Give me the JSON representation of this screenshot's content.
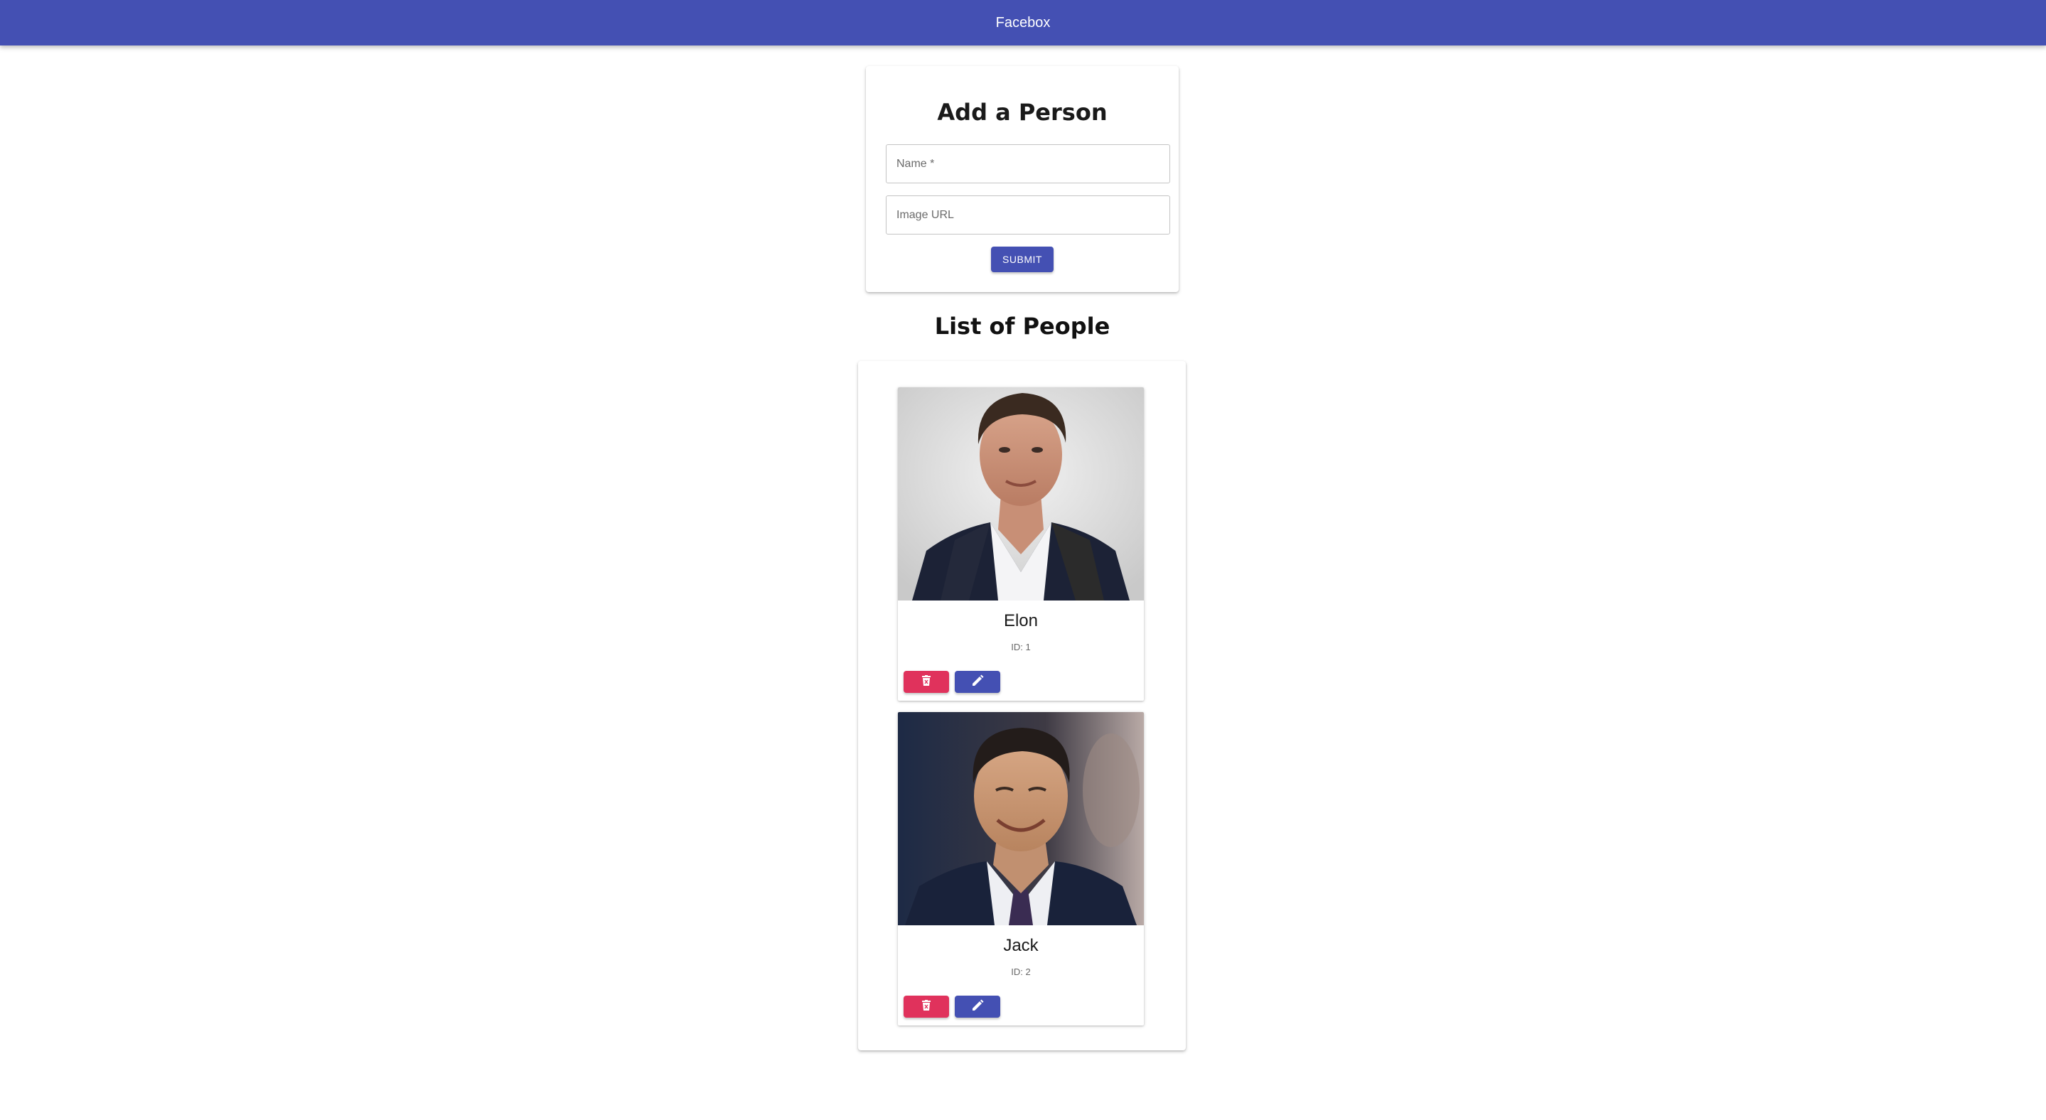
{
  "appbar": {
    "title": "Facebox"
  },
  "form": {
    "title": "Add a Person",
    "name_placeholder": "Name *",
    "name_value": "",
    "url_placeholder": "Image URL",
    "url_value": "",
    "submit_label": "SUBMIT"
  },
  "list": {
    "title": "List of People",
    "people": [
      {
        "name": "Elon",
        "id_text": "ID: 1"
      },
      {
        "name": "Jack",
        "id_text": "ID: 2"
      }
    ]
  },
  "colors": {
    "primary": "#4450b3",
    "danger": "#e0325c"
  },
  "icons": {
    "delete": "trash-icon",
    "edit": "pencil-icon"
  }
}
